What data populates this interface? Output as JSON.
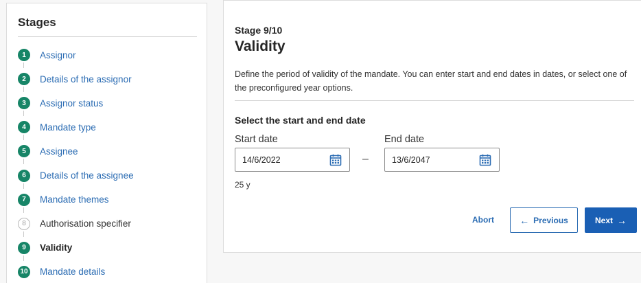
{
  "sidebar": {
    "title": "Stages",
    "items": [
      {
        "number": "1",
        "label": "Assignor",
        "state": "done"
      },
      {
        "number": "2",
        "label": "Details of the assignor",
        "state": "done"
      },
      {
        "number": "3",
        "label": "Assignor status",
        "state": "done"
      },
      {
        "number": "4",
        "label": "Mandate type",
        "state": "done"
      },
      {
        "number": "5",
        "label": "Assignee",
        "state": "done"
      },
      {
        "number": "6",
        "label": "Details of the assignee",
        "state": "done"
      },
      {
        "number": "7",
        "label": "Mandate themes",
        "state": "done"
      },
      {
        "number": "8",
        "label": "Authorisation specifier",
        "state": "pending"
      },
      {
        "number": "9",
        "label": "Validity",
        "state": "current"
      },
      {
        "number": "10",
        "label": "Mandate details",
        "state": "done"
      }
    ]
  },
  "main": {
    "stage_counter": "Stage 9/10",
    "title": "Validity",
    "description": "Define the period of validity of the mandate. You can enter start and end dates in dates, or select one of the preconfigured year options.",
    "section_title": "Select the start and end date",
    "start_date": {
      "label": "Start date",
      "value": "14/6/2022",
      "icon": "calendar-icon"
    },
    "separator": "–",
    "end_date": {
      "label": "End date",
      "value": "13/6/2047",
      "icon": "calendar-icon"
    },
    "duration": "25 y"
  },
  "actions": {
    "abort_label": "Abort",
    "previous_label": "Previous",
    "previous_icon": "arrow-left-icon",
    "next_label": "Next",
    "next_icon": "arrow-right-icon"
  },
  "colors": {
    "accent_green": "#178567",
    "link_blue": "#2b6cb3",
    "primary_button": "#1a5fb4"
  }
}
